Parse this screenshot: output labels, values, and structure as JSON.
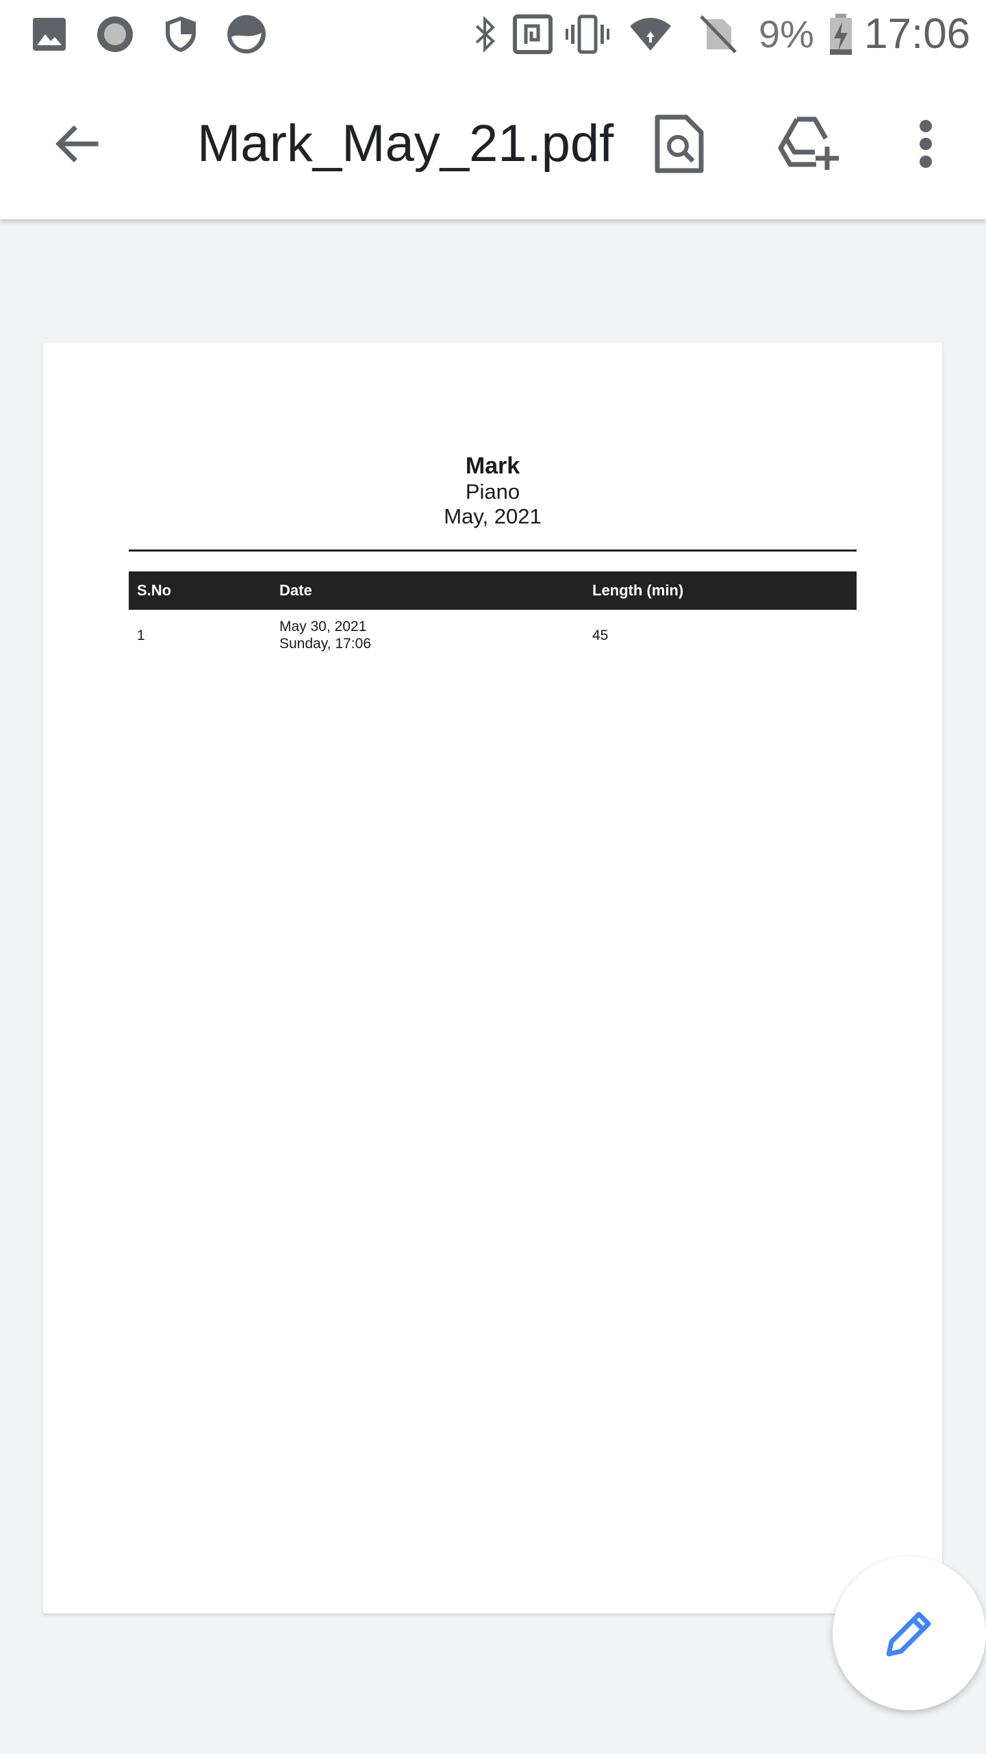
{
  "status_bar": {
    "battery_percent": "9%",
    "time": "17:06",
    "icons": [
      "gallery-icon",
      "record-icon",
      "shield-icon",
      "app-icon",
      "bluetooth-icon",
      "nfc-icon",
      "vibrate-icon",
      "wifi-icon",
      "no-sim-icon",
      "battery-charging-icon"
    ]
  },
  "app_bar": {
    "title": "Mark_May_21.pdf",
    "icons": [
      "back-arrow-icon",
      "find-in-document-icon",
      "add-to-drive-icon",
      "more-vert-icon"
    ]
  },
  "document": {
    "name": "Mark",
    "subtitle": "Piano",
    "period": "May, 2021",
    "table": {
      "headers": [
        "S.No",
        "Date",
        "Length (min)"
      ],
      "rows": [
        {
          "sno": "1",
          "date_line1": "May 30, 2021",
          "date_line2": "Sunday, 17:06",
          "length": "45"
        }
      ]
    }
  },
  "fab": {
    "icon": "edit-pencil-icon",
    "color": "#4285f4"
  },
  "colors": {
    "background": "#f1f3f4",
    "table_header": "#222222",
    "icon_grey": "#5f6368"
  }
}
